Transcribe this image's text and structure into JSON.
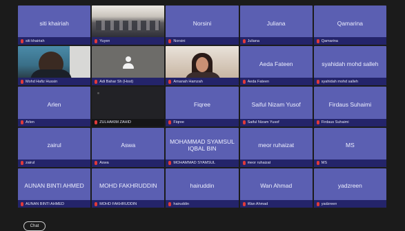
{
  "tiles": [
    {
      "name": "siti khairiah",
      "label": "siti khairiah"
    },
    {
      "name": "",
      "label": "Yuyen"
    },
    {
      "name": "Norsini",
      "label": "Norsini"
    },
    {
      "name": "Juliana",
      "label": "Juliana"
    },
    {
      "name": "Qamarina",
      "label": "Qamarina"
    },
    {
      "name": "",
      "label": "Mohd Hafiz Hussin"
    },
    {
      "name": "",
      "label": "Adi Bahar Sh (Host)"
    },
    {
      "name": "",
      "label": "Amanah Hamzah"
    },
    {
      "name": "Aeda Fateen",
      "label": "Aeda Fateen"
    },
    {
      "name": "syahidah mohd salleh",
      "label": "syahidah mohd salleh"
    },
    {
      "name": "Arlen",
      "label": "Arlen"
    },
    {
      "name": "",
      "label": "ZULHAKIM ZAHID"
    },
    {
      "name": "Fiqree",
      "label": "Fiqree"
    },
    {
      "name": "Saiful Nizam Yusof",
      "label": "Saiful Nizam Yusof"
    },
    {
      "name": "Firdaus Suhaimi",
      "label": "Firdaus Suhaimi"
    },
    {
      "name": "zairul",
      "label": "zairul"
    },
    {
      "name": "Aswa",
      "label": "Aswa"
    },
    {
      "name": "MOHAMMAD SYAMSUL IQBAL BIN",
      "label": "MOHAMMAD SYAMSUL"
    },
    {
      "name": "meor ruhaizat",
      "label": "meor ruhaizat"
    },
    {
      "name": "MS",
      "label": "MS"
    },
    {
      "name": "AUNAN BINTI AHMED",
      "label": "AUNAN BINTI AHMED"
    },
    {
      "name": "MOHD FAKHRUDDIN",
      "label": "MOHD FAKHRUDDIN"
    },
    {
      "name": "hairuddin",
      "label": "hairuddin"
    },
    {
      "name": "Wan Ahmad",
      "label": "Wan Ahmad"
    },
    {
      "name": "yadzreen",
      "label": "yadzreen"
    }
  ],
  "toolbar": {
    "chat_label": "Chat"
  }
}
